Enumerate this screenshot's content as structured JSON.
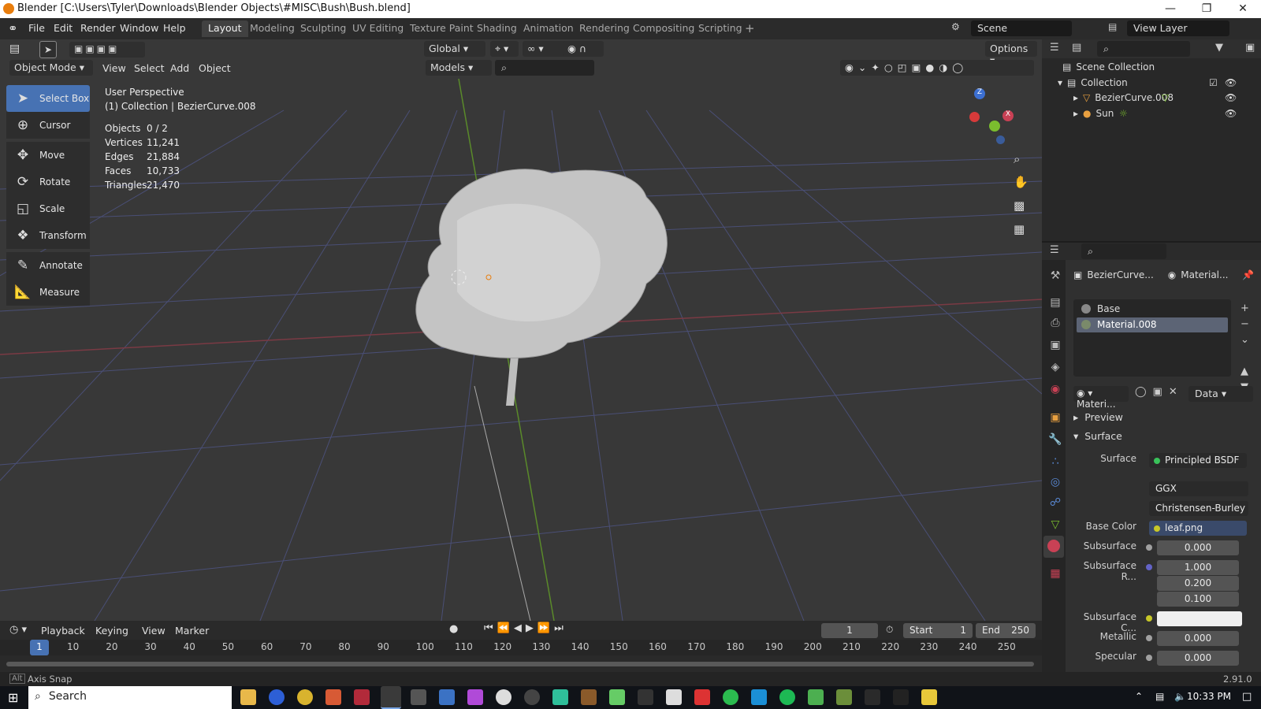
{
  "title": "Blender [C:\\Users\\Tyler\\Downloads\\Blender Objects\\#MISC\\Bush\\Bush.blend]",
  "menus": [
    "File",
    "Edit",
    "Render",
    "Window",
    "Help"
  ],
  "workspaces": [
    "Layout",
    "Modeling",
    "Sculpting",
    "UV Editing",
    "Texture Paint",
    "Shading",
    "Animation",
    "Rendering",
    "Compositing",
    "Scripting"
  ],
  "scene": "Scene",
  "view_layer": "View Layer",
  "viewport": {
    "mode": "Object Mode",
    "menus": [
      "View",
      "Select",
      "Add",
      "Object"
    ],
    "orientation": "Global",
    "collection_filter": "Models",
    "options": "Options",
    "perspective": "User Perspective",
    "collection_line": "(1) Collection | BezierCurve.008",
    "stats": [
      {
        "k": "Objects",
        "v": "0 / 2"
      },
      {
        "k": "Vertices",
        "v": "11,241"
      },
      {
        "k": "Edges",
        "v": "21,884"
      },
      {
        "k": "Faces",
        "v": "10,733"
      },
      {
        "k": "Triangles",
        "v": "21,470"
      }
    ]
  },
  "tools": [
    "Select Box",
    "Cursor",
    "Move",
    "Rotate",
    "Scale",
    "Transform",
    "Annotate",
    "Measure"
  ],
  "outliner": {
    "scene_collection": "Scene Collection",
    "collection": "Collection",
    "items": [
      "BezierCurve.008",
      "Sun"
    ]
  },
  "props": {
    "object": "BezierCurve...",
    "material": "Material...",
    "slots": [
      "Base",
      "Material.008"
    ],
    "mat_name": "Materi...",
    "data": "Data",
    "preview": "Preview",
    "surface_panel": "Surface",
    "rows": [
      {
        "label": "Surface",
        "value": "Principled BSDF"
      },
      {
        "label": "",
        "value": "GGX"
      },
      {
        "label": "",
        "value": "Christensen-Burley"
      },
      {
        "label": "Base Color",
        "value": "leaf.png"
      },
      {
        "label": "Subsurface",
        "value": "0.000"
      },
      {
        "label": "Subsurface R...",
        "value": "1.000"
      },
      {
        "label": "",
        "value": "0.200"
      },
      {
        "label": "",
        "value": "0.100"
      },
      {
        "label": "Subsurface C...",
        "value": ""
      },
      {
        "label": "Metallic",
        "value": "0.000"
      },
      {
        "label": "Specular",
        "value": "0.000"
      }
    ]
  },
  "timeline": {
    "menus": [
      "Playback",
      "Keying",
      "View",
      "Marker"
    ],
    "frame": "1",
    "start_label": "Start",
    "start": "1",
    "end_label": "End",
    "end": "250",
    "ticks": [
      "1",
      "10",
      "20",
      "30",
      "40",
      "50",
      "60",
      "70",
      "80",
      "90",
      "100",
      "110",
      "120",
      "130",
      "140",
      "150",
      "160",
      "170",
      "180",
      "190",
      "200",
      "210",
      "220",
      "230",
      "240",
      "250"
    ]
  },
  "status": {
    "left": "Axis Snap",
    "version": "2.91.0"
  },
  "taskbar": {
    "search": "Search",
    "time": "10:33 PM"
  }
}
